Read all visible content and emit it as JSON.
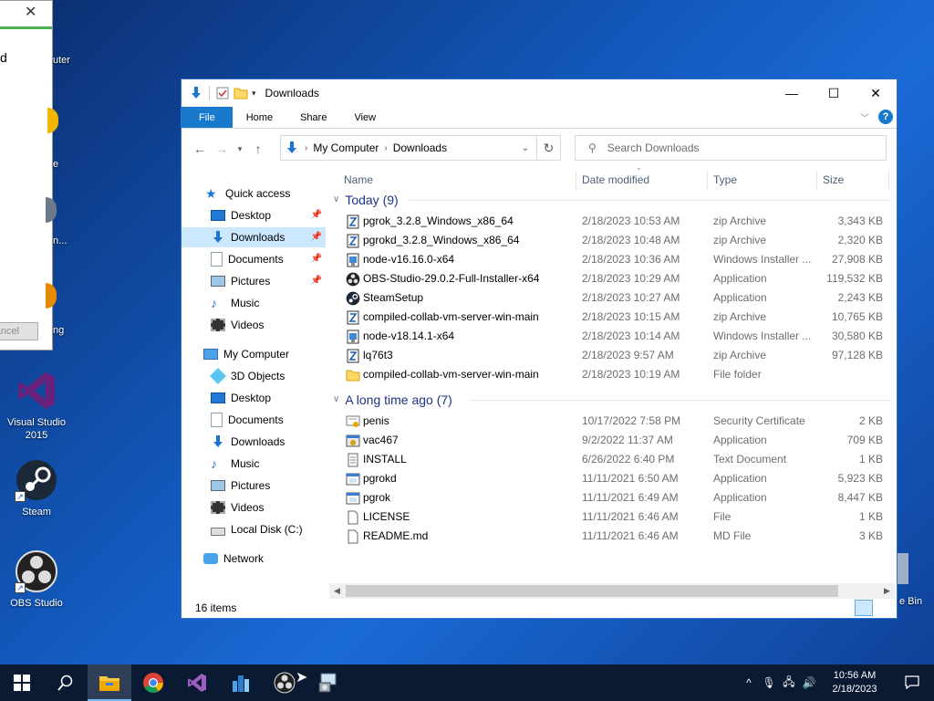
{
  "desktop": {
    "partial_labels": [
      "uter",
      "e",
      "n...",
      "ng",
      "e Bin"
    ],
    "icons": [
      {
        "label": "Visual Studio 2015",
        "icon": "visual-studio-icon"
      },
      {
        "label": "Steam",
        "icon": "steam-icon"
      },
      {
        "label": "OBS Studio",
        "icon": "obs-icon"
      }
    ],
    "dialog": {
      "letter": "d",
      "cancel_label": "ancel"
    }
  },
  "window": {
    "title": "Downloads",
    "ribbon_tabs": [
      "File",
      "Home",
      "Share",
      "View"
    ],
    "address": {
      "crumbs": [
        "My Computer",
        "Downloads"
      ]
    },
    "search_placeholder": "Search Downloads",
    "columns": {
      "name": "Name",
      "date": "Date modified",
      "type": "Type",
      "size": "Size"
    },
    "sidebar": {
      "quick_access": "Quick access",
      "quick_items": [
        "Desktop",
        "Downloads",
        "Documents",
        "Pictures",
        "Music",
        "Videos"
      ],
      "computer": "My Computer",
      "computer_items": [
        "3D Objects",
        "Desktop",
        "Documents",
        "Downloads",
        "Music",
        "Pictures",
        "Videos",
        "Local Disk (C:)"
      ],
      "network": "Network"
    },
    "groups": [
      {
        "title": "Today (9)",
        "rows": [
          {
            "name": "pgrok_3.2.8_Windows_x86_64",
            "date": "2/18/2023 10:53 AM",
            "type": "zip Archive",
            "size": "3,343 KB",
            "icon": "zip-icon"
          },
          {
            "name": "pgrokd_3.2.8_Windows_x86_64",
            "date": "2/18/2023 10:48 AM",
            "type": "zip Archive",
            "size": "2,320 KB",
            "icon": "zip-icon"
          },
          {
            "name": "node-v16.16.0-x64",
            "date": "2/18/2023 10:36 AM",
            "type": "Windows Installer ...",
            "size": "27,908 KB",
            "icon": "msi-icon"
          },
          {
            "name": "OBS-Studio-29.0.2-Full-Installer-x64",
            "date": "2/18/2023 10:29 AM",
            "type": "Application",
            "size": "119,532 KB",
            "icon": "obs-icon"
          },
          {
            "name": "SteamSetup",
            "date": "2/18/2023 10:27 AM",
            "type": "Application",
            "size": "2,243 KB",
            "icon": "steam-icon"
          },
          {
            "name": "compiled-collab-vm-server-win-main",
            "date": "2/18/2023 10:15 AM",
            "type": "zip Archive",
            "size": "10,765 KB",
            "icon": "zip-icon"
          },
          {
            "name": "node-v18.14.1-x64",
            "date": "2/18/2023 10:14 AM",
            "type": "Windows Installer ...",
            "size": "30,580 KB",
            "icon": "msi-icon"
          },
          {
            "name": "lq76t3",
            "date": "2/18/2023 9:57 AM",
            "type": "zip Archive",
            "size": "97,128 KB",
            "icon": "zip-icon"
          },
          {
            "name": "compiled-collab-vm-server-win-main",
            "date": "2/18/2023 10:19 AM",
            "type": "File folder",
            "size": "",
            "icon": "folder-icon"
          }
        ]
      },
      {
        "title": "A long time ago (7)",
        "rows": [
          {
            "name": "penis",
            "date": "10/17/2022 7:58 PM",
            "type": "Security Certificate",
            "size": "2 KB",
            "icon": "certificate-icon"
          },
          {
            "name": "vac467",
            "date": "9/2/2022 11:37 AM",
            "type": "Application",
            "size": "709 KB",
            "icon": "app-icon"
          },
          {
            "name": "INSTALL",
            "date": "6/26/2022 6:40 PM",
            "type": "Text Document",
            "size": "1 KB",
            "icon": "text-file-icon"
          },
          {
            "name": "pgrokd",
            "date": "11/11/2021 6:50 AM",
            "type": "Application",
            "size": "5,923 KB",
            "icon": "exe-icon"
          },
          {
            "name": "pgrok",
            "date": "11/11/2021 6:49 AM",
            "type": "Application",
            "size": "8,447 KB",
            "icon": "exe-icon"
          },
          {
            "name": "LICENSE",
            "date": "11/11/2021 6:46 AM",
            "type": "File",
            "size": "1 KB",
            "icon": "blank-file-icon"
          },
          {
            "name": "README.md",
            "date": "11/11/2021 6:46 AM",
            "type": "MD File",
            "size": "3 KB",
            "icon": "blank-file-icon"
          }
        ]
      }
    ],
    "status": "16 items"
  },
  "taskbar": {
    "apps": [
      "start-icon",
      "search-icon",
      "file-explorer-icon",
      "chrome-icon",
      "visual-studio-icon",
      "app-icon",
      "obs-icon",
      "installer-icon"
    ],
    "clock": {
      "time": "10:56 AM",
      "date": "2/18/2023"
    }
  },
  "colors": {
    "accent": "#1979ca",
    "selection": "#cce8ff",
    "group_header": "#1e3287",
    "taskbar": "#0a1a33"
  }
}
